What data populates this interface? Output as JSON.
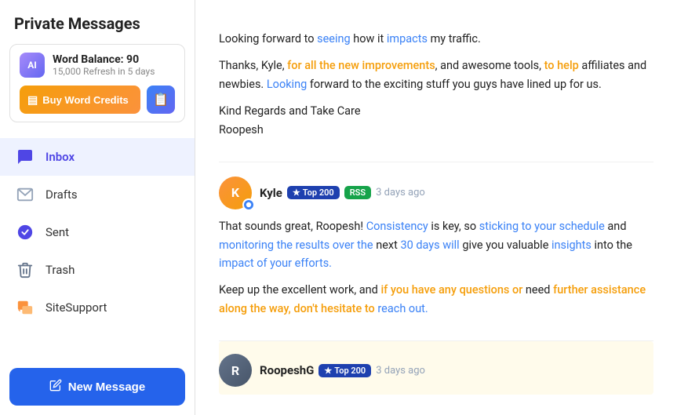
{
  "sidebar": {
    "title": "Private Messages",
    "word_balance": {
      "ai_label": "AI",
      "balance_label": "Word Balance: 90",
      "refresh_label": "15,000 Refresh in 5 days",
      "buy_credits_label": "Buy Word Credits",
      "doc_icon": "📄"
    },
    "nav_items": [
      {
        "id": "inbox",
        "label": "Inbox",
        "active": true
      },
      {
        "id": "drafts",
        "label": "Drafts",
        "active": false
      },
      {
        "id": "sent",
        "label": "Sent",
        "active": false
      },
      {
        "id": "trash",
        "label": "Trash",
        "active": false
      },
      {
        "id": "sitesupport",
        "label": "SiteSupport",
        "active": false
      }
    ],
    "new_message_label": "New Message"
  },
  "messages": [
    {
      "id": "msg1",
      "type": "plain",
      "paragraphs": [
        "Looking forward to seeing how it impacts my traffic.",
        "Thanks, Kyle, for all the new improvements, and awesome tools, to help affiliates and newbies. Looking forward to the exciting stuff you guys have lined up for us.",
        "Kind Regards and Take Care\nRoopesh"
      ]
    },
    {
      "id": "msg2",
      "type": "with-header",
      "sender": "Kyle",
      "avatar_initials": "K",
      "avatar_class": "avatar-kyle",
      "badge_top200": "Top 200",
      "badge_rss": "RSS",
      "timestamp": "3 days ago",
      "paragraphs": [
        "That sounds great, Roopesh! Consistency is key, so sticking to your schedule and monitoring the results over the next 30 days will give you valuable insights into the impact of your efforts.",
        "Keep up the excellent work, and if you have any questions or need further assistance along the way, don't hesitate to reach out."
      ]
    },
    {
      "id": "msg3",
      "type": "partial-header",
      "sender": "RoopeshG",
      "avatar_initials": "R",
      "avatar_class": "avatar-roopesh",
      "badge_top200": "Top 200",
      "timestamp": "3 days ago",
      "paragraphs": []
    }
  ],
  "icons": {
    "inbox": "💬",
    "drafts": "✉",
    "sent": "✔",
    "trash": "🗑",
    "sitesupport": "💬",
    "new_message": "✏",
    "badge_icon": "★"
  }
}
